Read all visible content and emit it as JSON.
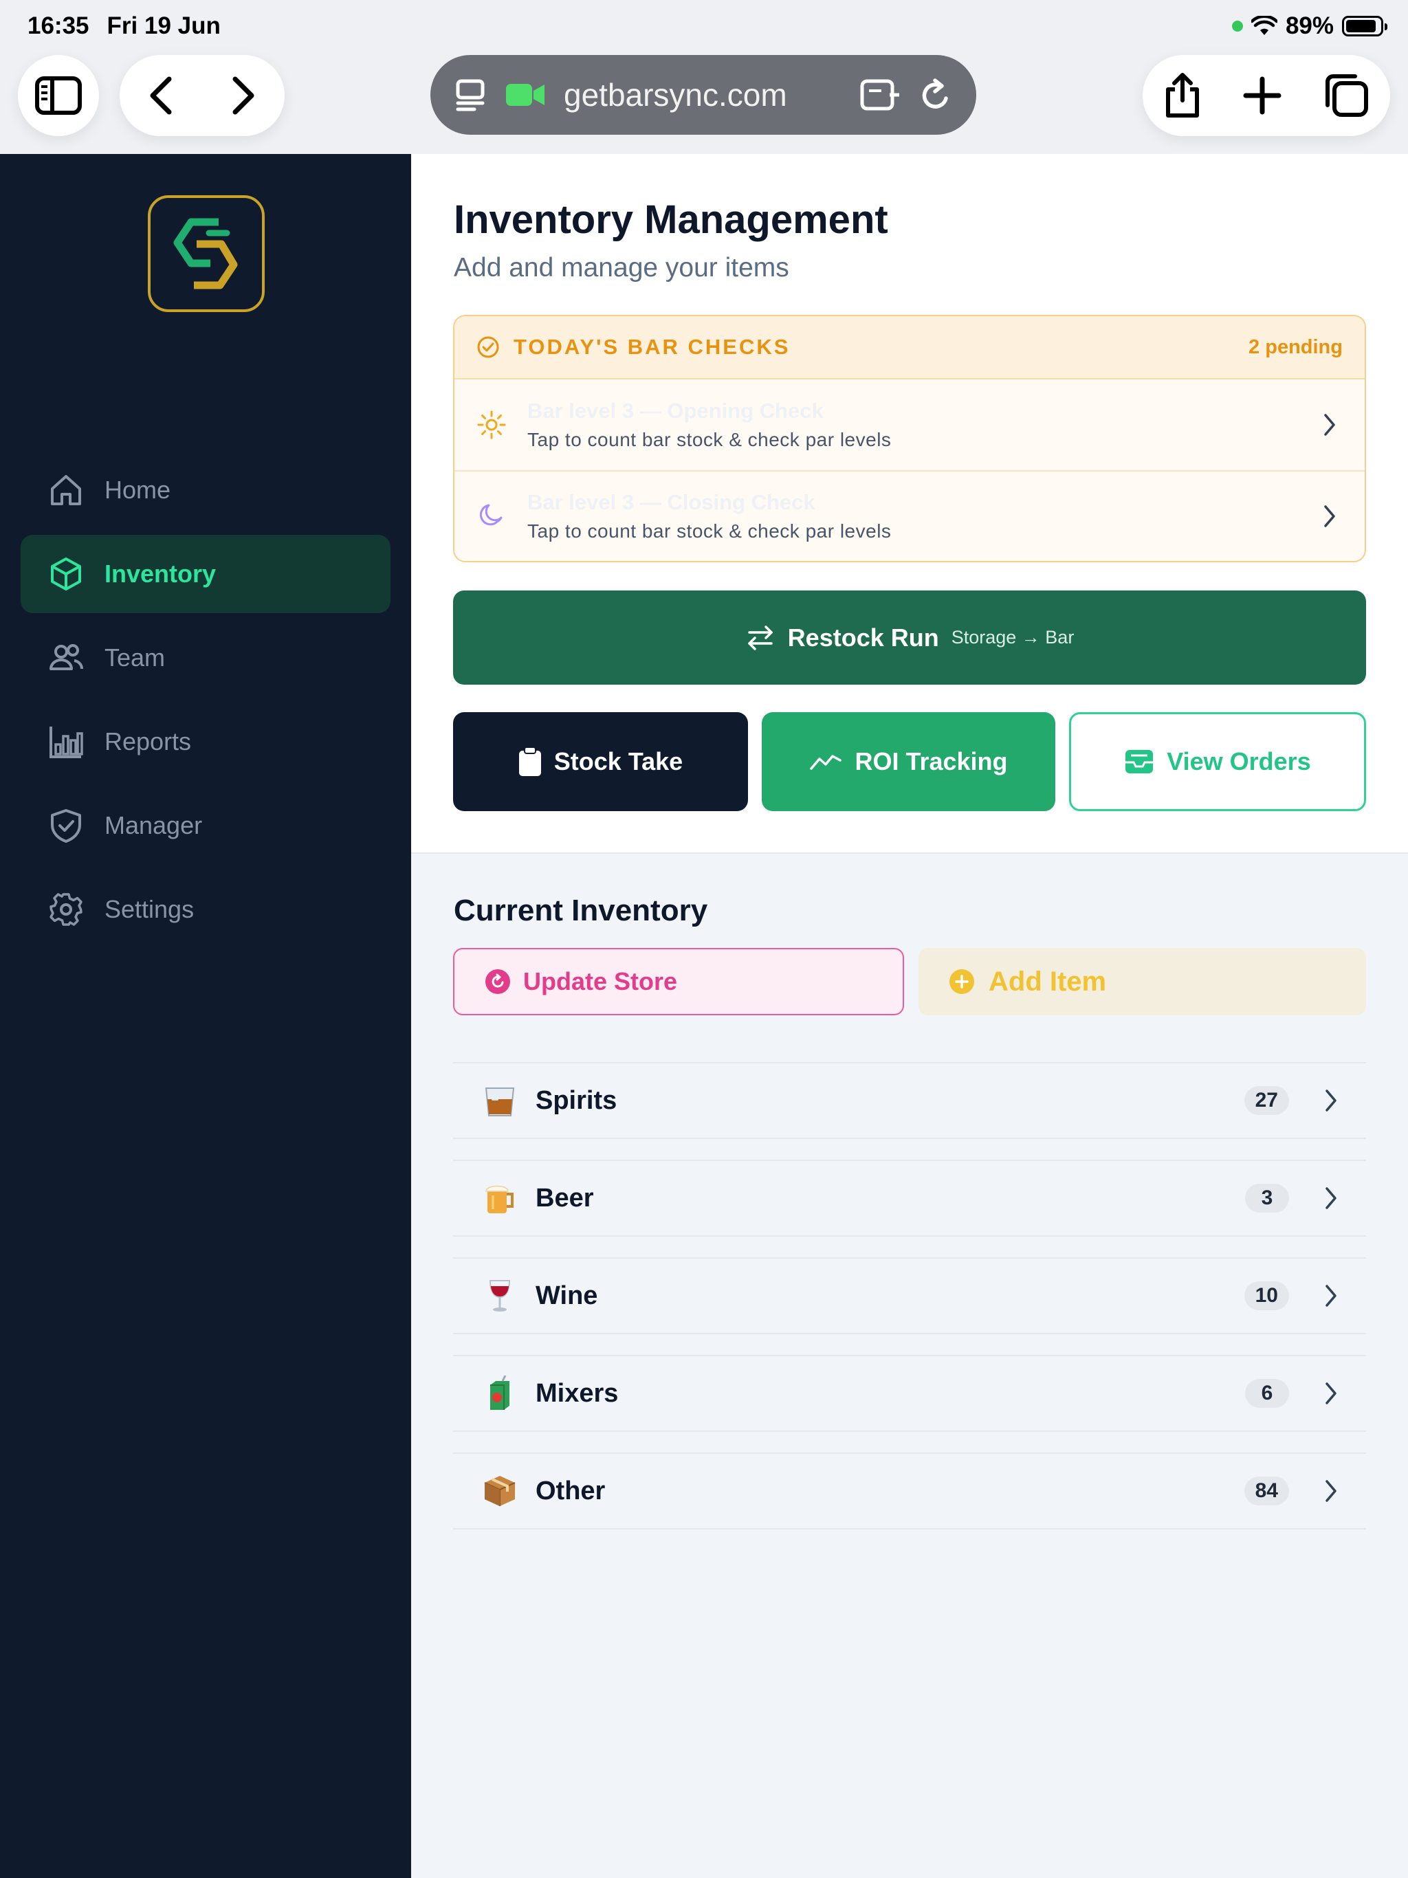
{
  "status_bar": {
    "time": "16:35",
    "date": "Fri 19 Jun",
    "battery": "89%",
    "battery_level": 0.89
  },
  "browser": {
    "url": "getbarsync.com"
  },
  "sidebar": {
    "items": [
      {
        "label": "Home",
        "icon": "home-icon",
        "active": false
      },
      {
        "label": "Inventory",
        "icon": "box-icon",
        "active": true
      },
      {
        "label": "Team",
        "icon": "users-icon",
        "active": false
      },
      {
        "label": "Reports",
        "icon": "bar-chart-icon",
        "active": false
      },
      {
        "label": "Manager",
        "icon": "shield-icon",
        "active": false
      },
      {
        "label": "Settings",
        "icon": "gear-icon",
        "active": false
      }
    ]
  },
  "header": {
    "title": "Inventory Management",
    "subtitle": "Add and manage your items"
  },
  "bar_checks": {
    "title": "TODAY'S BAR CHECKS",
    "pending": "2 pending",
    "items": [
      {
        "name": "Bar level 3 — Opening Check",
        "desc": "Tap to count bar stock & check par levels",
        "icon": "sun-icon"
      },
      {
        "name": "Bar level 3 — Closing Check",
        "desc": "Tap to count bar stock & check par levels",
        "icon": "moon-icon"
      }
    ]
  },
  "restock": {
    "label": "Restock Run",
    "route": "Storage → Bar"
  },
  "actions": {
    "stock_take": "Stock Take",
    "roi": "ROI Tracking",
    "orders": "View Orders"
  },
  "inventory": {
    "title": "Current Inventory",
    "update_store": "Update Store",
    "add_item": "Add Item",
    "categories": [
      {
        "name": "Spirits",
        "count": "27",
        "icon": "whisky-glass-icon"
      },
      {
        "name": "Beer",
        "count": "3",
        "icon": "beer-mug-icon"
      },
      {
        "name": "Wine",
        "count": "10",
        "icon": "wine-glass-icon"
      },
      {
        "name": "Mixers",
        "count": "6",
        "icon": "juice-box-icon"
      },
      {
        "name": "Other",
        "count": "84",
        "icon": "package-icon"
      }
    ]
  },
  "colors": {
    "sidebar_bg": "#0f1b2d",
    "accent_green": "#2ee59d",
    "restock_bg": "#1f6b4f",
    "roi_bg": "#22a96b",
    "warning": "#e79312",
    "pink": "#e23c8a",
    "yellow": "#f1c231"
  }
}
